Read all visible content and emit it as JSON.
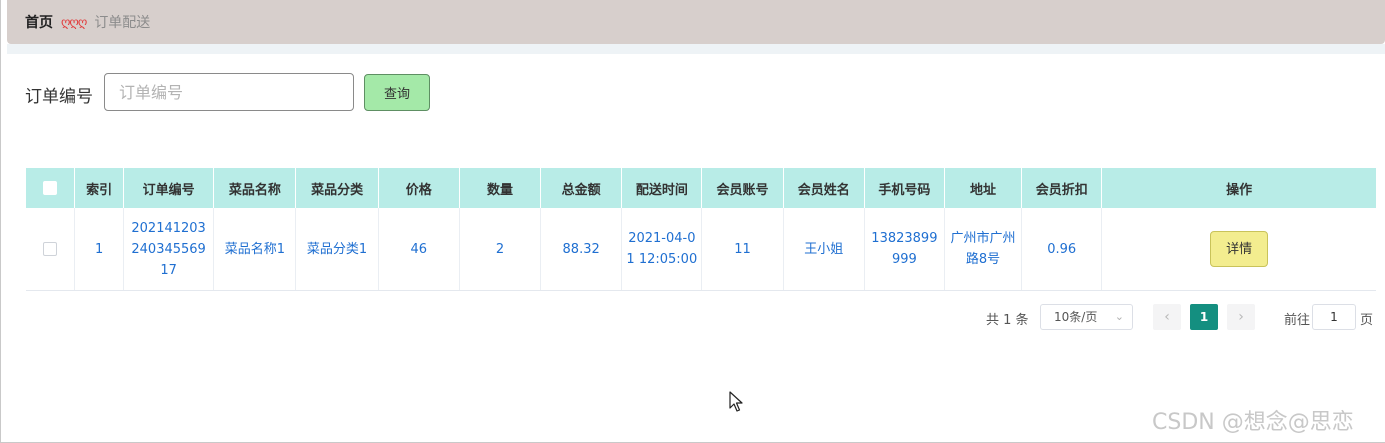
{
  "breadcrumb": {
    "home": "首页",
    "separator": "ღღღ",
    "current": "订单配送"
  },
  "search": {
    "label": "订单编号",
    "placeholder": "订单编号",
    "value": "",
    "button": "查询"
  },
  "table": {
    "headers": {
      "index": "索引",
      "order_no": "订单编号",
      "dish_name": "菜品名称",
      "dish_category": "菜品分类",
      "price": "价格",
      "quantity": "数量",
      "total": "总金额",
      "delivery_time": "配送时间",
      "member_account": "会员账号",
      "member_name": "会员姓名",
      "phone": "手机号码",
      "address": "地址",
      "discount": "会员折扣",
      "actions": "操作"
    },
    "rows": [
      {
        "index": "1",
        "order_no": "202141203240345569 17",
        "dish_name": "菜品名称1",
        "dish_category": "菜品分类1",
        "price": "46",
        "quantity": "2",
        "total": "88.32",
        "delivery_time": "2021-04-01 12:05:00",
        "member_account": "11",
        "member_name": "王小姐",
        "phone": "13823899999",
        "address": "广州市广州路8号",
        "discount": "0.96",
        "action_label": "详情"
      }
    ]
  },
  "pagination": {
    "total": "共 1 条",
    "page_size": "10条/页",
    "current_page": "1",
    "goto_label": "前往",
    "goto_value": "1",
    "page_unit": "页"
  },
  "watermark": "CSDN @想念@思恋",
  "colors": {
    "header_bg": "#b8ece7",
    "query_button": "#a4e9a8",
    "detail_button": "#f3ed8f",
    "active_page": "#148f80",
    "link_text": "#1f6fd1"
  }
}
